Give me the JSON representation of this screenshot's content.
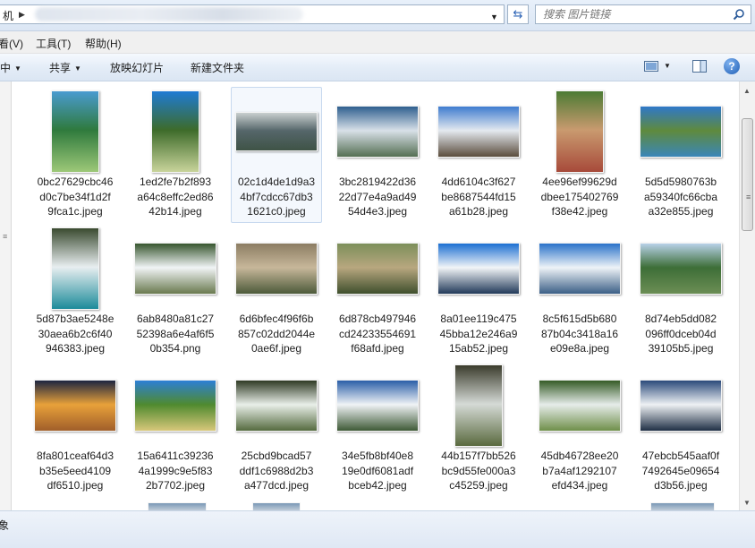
{
  "address": {
    "text": "机",
    "separator": "▶",
    "dropdown": "▼"
  },
  "refresh_glyph": "⇆",
  "search": {
    "placeholder": "搜索 图片链接"
  },
  "menu": [
    "看(V)",
    "工具(T)",
    "帮助(H)"
  ],
  "toolbar": {
    "organize": "中",
    "share": "共享",
    "slideshow": "放映幻灯片",
    "new_folder": "新建文件夹",
    "help": "?"
  },
  "files": [
    {
      "name": "0bc27629cbc46d0c7be34f1d2f9fca1c.jpeg",
      "label": [
        "0bc27629cbc46",
        "d0c7be34f1d2f",
        "9fca1c.jpeg"
      ],
      "ratio": "portrait",
      "colors": [
        "#4a9bd0",
        "#2f7a3d",
        "#9dc878"
      ]
    },
    {
      "name": "1ed2fe7b2f893a64c8effc2ed8642b14.jpeg",
      "label": [
        "1ed2fe7b2f893",
        "a64c8effc2ed86",
        "42b14.jpeg"
      ],
      "ratio": "portrait",
      "colors": [
        "#1f7bd4",
        "#3d6b2a",
        "#c9d49b"
      ]
    },
    {
      "name": "02c1d4de1d9a34bf7cdcc67db31621c0.jpeg",
      "label": [
        "02c1d4de1d9a3",
        "4bf7cdcc67db3",
        "1621c0.jpeg"
      ],
      "ratio": "land",
      "colors": [
        "#c9cfcf",
        "#55666a",
        "#3f5346"
      ]
    },
    {
      "name": "3bc2819422d3622d77e4a9ad4954d4e3.jpeg",
      "label": [
        "3bc2819422d36",
        "22d77e4a9ad49",
        "54d4e3.jpeg"
      ],
      "ratio": "land",
      "colors": [
        "#2f5f8f",
        "#d8e0e8",
        "#556f53"
      ]
    },
    {
      "name": "4dd6104c3f627be8687544fd15a61b28.jpeg",
      "label": [
        "4dd6104c3f627",
        "be8687544fd15",
        "a61b28.jpeg"
      ],
      "ratio": "land",
      "colors": [
        "#3f7ccf",
        "#e4e9ef",
        "#5b4d3d"
      ]
    },
    {
      "name": "4ee96ef99629ddbee175402769f38e42.jpeg",
      "label": [
        "4ee96ef99629d",
        "dbee175402769",
        "f38e42.jpeg"
      ],
      "ratio": "portrait",
      "colors": [
        "#4c7b34",
        "#c99a6f",
        "#a74a3a"
      ]
    },
    {
      "name": "5d5d5980763ba59340fc66cbaa32e855.jpeg",
      "label": [
        "5d5d5980763b",
        "a59340fc66cba",
        "a32e855.jpeg"
      ],
      "ratio": "land",
      "colors": [
        "#2f78c9",
        "#5f8a3d",
        "#3a86b8"
      ]
    },
    {
      "name": "5d87b3ae5248e30aea6b2c6f40946383.jpeg",
      "label": [
        "5d87b3ae5248e",
        "30aea6b2c6f40",
        "946383.jpeg"
      ],
      "ratio": "portrait",
      "colors": [
        "#3a4a2f",
        "#e8eef0",
        "#1c8b9a"
      ]
    },
    {
      "name": "6ab8480a81c2752398a6e4af6f50b354.png",
      "label": [
        "6ab8480a81c27",
        "52398a6e4af6f5",
        "0b354.png"
      ],
      "ratio": "land",
      "colors": [
        "#37562f",
        "#f1f4f6",
        "#6a7a4f"
      ]
    },
    {
      "name": "6d6bfec4f96f6b857c02dd2044e0ae6f.jpeg",
      "label": [
        "6d6bfec4f96f6b",
        "857c02dd2044e",
        "0ae6f.jpeg"
      ],
      "ratio": "land",
      "colors": [
        "#8c7d63",
        "#c7b79a",
        "#4d5a3a"
      ]
    },
    {
      "name": "6d878cb497946cd24233554691f68afd.jpeg",
      "label": [
        "6d878cb497946",
        "cd24233554691",
        "f68afd.jpeg"
      ],
      "ratio": "land",
      "colors": [
        "#7c8f5a",
        "#b8a77f",
        "#3f4f2d"
      ]
    },
    {
      "name": "8a01ee119c47545bba12e246a915ab52.jpeg",
      "label": [
        "8a01ee119c475",
        "45bba12e246a9",
        "15ab52.jpeg"
      ],
      "ratio": "land",
      "colors": [
        "#1c6fd2",
        "#f2f5f7",
        "#223a5a"
      ]
    },
    {
      "name": "8c5f615d5b68087b04c3418a16e09e8a.jpeg",
      "label": [
        "8c5f615d5b680",
        "87b04c3418a16",
        "e09e8a.jpeg"
      ],
      "ratio": "land",
      "colors": [
        "#2a72c9",
        "#eef3f7",
        "#3b5f86"
      ]
    },
    {
      "name": "8d74eb5dd082096ff0dceb04d39105b5.jpeg",
      "label": [
        "8d74eb5dd082",
        "096ff0dceb04d",
        "39105b5.jpeg"
      ],
      "ratio": "land",
      "colors": [
        "#b8d1e8",
        "#3d6e37",
        "#6c8e55"
      ]
    },
    {
      "name": "8fa801ceaf64d3b35e5eed4109df6510.jpeg",
      "label": [
        "8fa801ceaf64d3",
        "b35e5eed4109",
        "df6510.jpeg"
      ],
      "ratio": "land",
      "colors": [
        "#1d2540",
        "#e8a13a",
        "#a05e2a"
      ]
    },
    {
      "name": "15a6411c392364a1999c9e5f832b7702.jpeg",
      "label": [
        "15a6411c39236",
        "4a1999c9e5f83",
        "2b7702.jpeg"
      ],
      "ratio": "land",
      "colors": [
        "#2c7fd6",
        "#4f8a2f",
        "#d7c77a"
      ]
    },
    {
      "name": "25cbd9bcad57ddf1c6988d2b3a477dcd.jpeg",
      "label": [
        "25cbd9bcad57",
        "ddf1c6988d2b3",
        "a477dcd.jpeg"
      ],
      "ratio": "land",
      "colors": [
        "#2f3a24",
        "#e9efe9",
        "#556b3f"
      ]
    },
    {
      "name": "34e5fb8bf40e819e0df6081adfbceb42.jpeg",
      "label": [
        "34e5fb8bf40e8",
        "19e0df6081adf",
        "bceb42.jpeg"
      ],
      "ratio": "land",
      "colors": [
        "#2a5ea8",
        "#f0f3f6",
        "#3e5a36"
      ]
    },
    {
      "name": "44b157f7bb526bc9d55fe000a3c45259.jpeg",
      "label": [
        "44b157f7bb526",
        "bc9d55fe000a3",
        "c45259.jpeg"
      ],
      "ratio": "portrait",
      "colors": [
        "#3b3c2c",
        "#d5dad6",
        "#5a6a3f"
      ]
    },
    {
      "name": "45db46728ee20b7a4af1292107efd434.jpeg",
      "label": [
        "45db46728ee20",
        "b7a4af1292107",
        "efd434.jpeg"
      ],
      "ratio": "land",
      "colors": [
        "#355b26",
        "#e6ecea",
        "#6f8f4a"
      ]
    },
    {
      "name": "47ebcb545aaf0f7492645e09654d3b56.jpeg",
      "label": [
        "47ebcb545aaf0f",
        "7492645e09654",
        "d3b56.jpeg"
      ],
      "ratio": "land",
      "colors": [
        "#2b4a7a",
        "#eef1f4",
        "#1f2f45"
      ]
    }
  ],
  "status": {
    "text": "象"
  }
}
